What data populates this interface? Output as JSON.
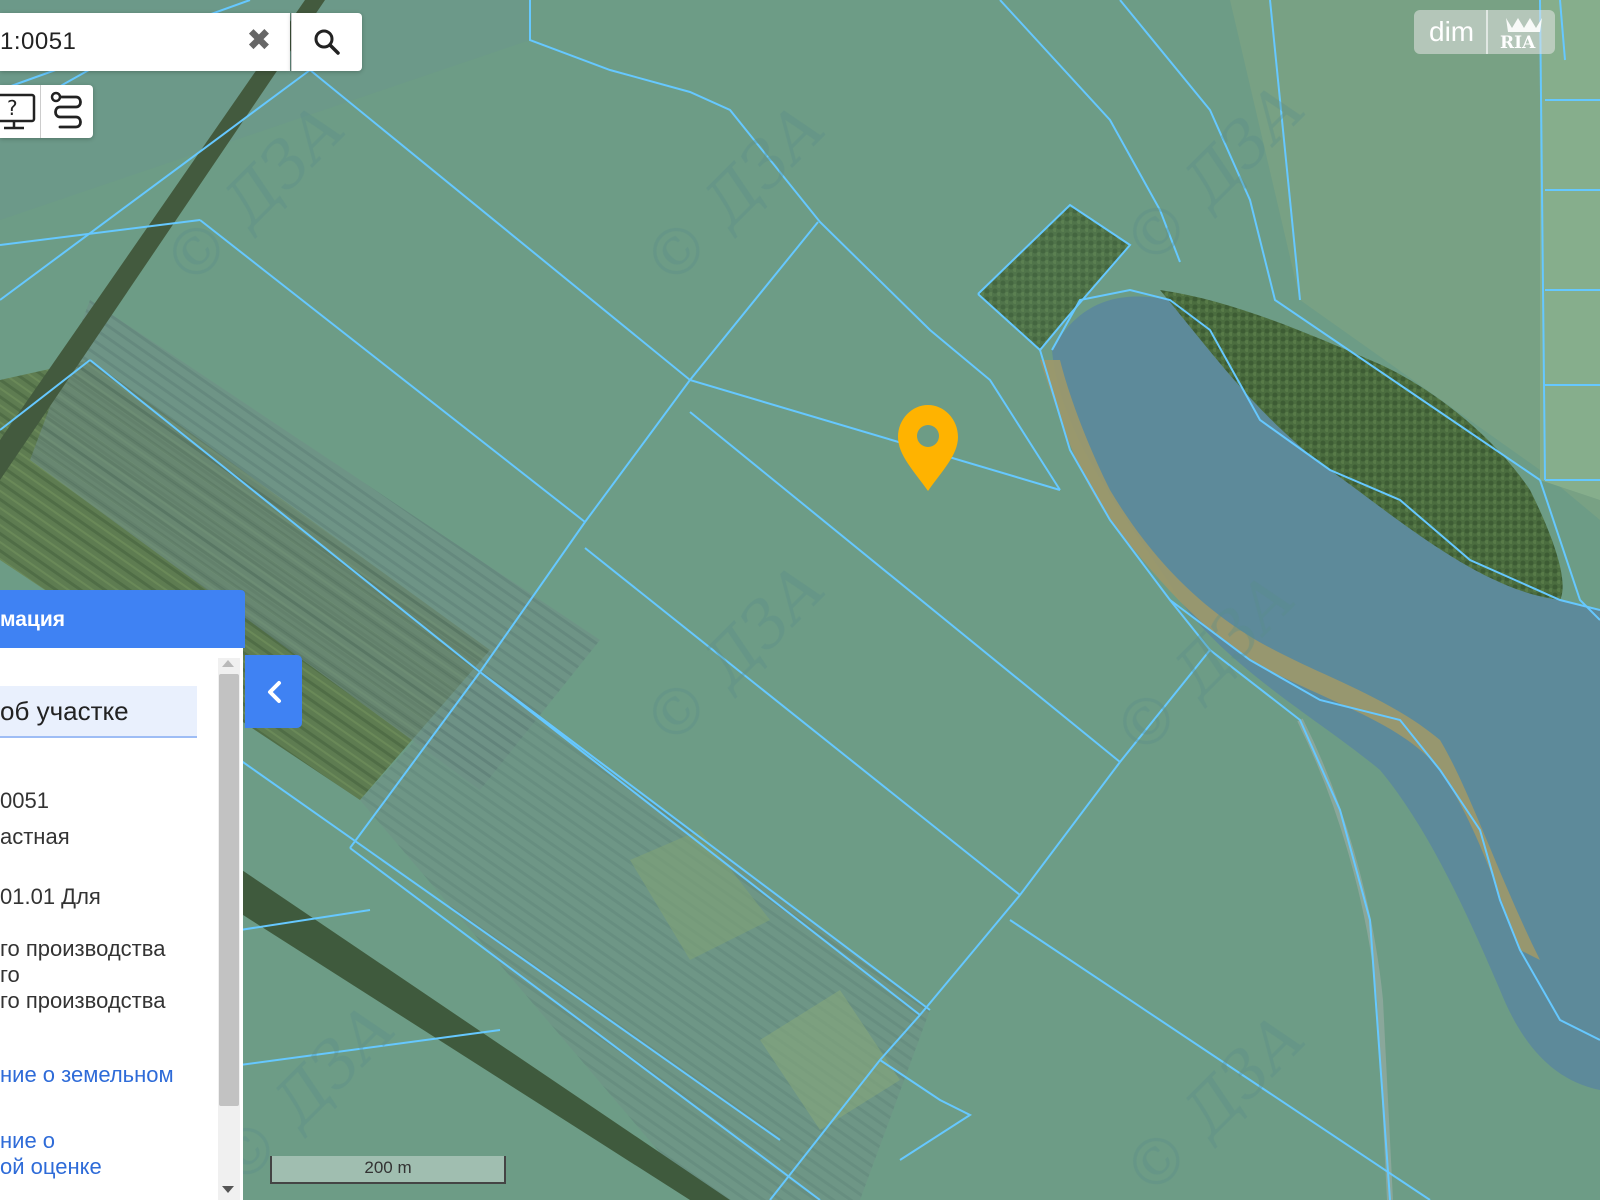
{
  "search": {
    "value": "1:0051"
  },
  "logo": {
    "brand": "dim",
    "partner": "RIA"
  },
  "map": {
    "watermark": "© ДЗА",
    "marker_color": "#ffb300",
    "parcel_line_color": "#66c8ff"
  },
  "panel": {
    "title": "мация",
    "tab": "об участке",
    "lines": [
      "0051",
      "астная",
      "01.01 Для",
      "го производства",
      "го",
      "го производства"
    ],
    "links": [
      "ние о земельном",
      "ние о",
      "ой оценке"
    ],
    "accent_color": "#3f82f3"
  },
  "scale": {
    "label": "200 m"
  }
}
